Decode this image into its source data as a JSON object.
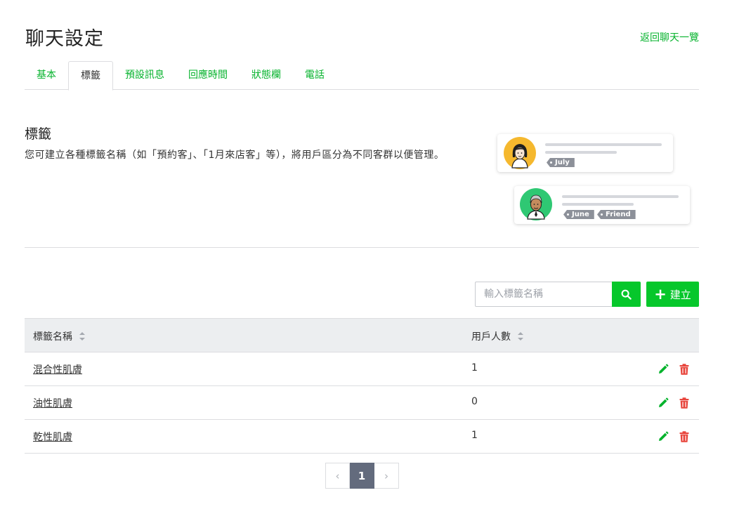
{
  "header": {
    "title": "聊天設定",
    "back_link": "返回聊天一覽"
  },
  "tabs": [
    {
      "label": "基本",
      "active": false
    },
    {
      "label": "標籤",
      "active": true
    },
    {
      "label": "預設訊息",
      "active": false
    },
    {
      "label": "回應時間",
      "active": false
    },
    {
      "label": "狀態欄",
      "active": false
    },
    {
      "label": "電話",
      "active": false
    }
  ],
  "section": {
    "title": "標籤",
    "description": "您可建立各種標籤名稱（如「預約客」、「1月來店客」等），將用戶區分為不同客群以便管理。"
  },
  "illustration": {
    "tag_1": "July",
    "tag_2": "June",
    "tag_3": "Friend"
  },
  "toolbar": {
    "search_placeholder": "輸入標籤名稱",
    "search_value": "",
    "create_label": "建立",
    "search_icon": "magnifier-icon"
  },
  "table": {
    "columns": {
      "name": "標籤名稱",
      "count": "用戶人數"
    },
    "rows": [
      {
        "name": "混合性肌膚",
        "count": "1"
      },
      {
        "name": "油性肌膚",
        "count": "0"
      },
      {
        "name": "乾性肌膚",
        "count": "1"
      }
    ]
  },
  "pagination": {
    "prev": "‹",
    "current": "1",
    "next": "›"
  },
  "colors": {
    "accent": "#06c72b",
    "link": "#06b32d",
    "delete": "#e8453c",
    "header_bg": "#eceef0",
    "pager_active": "#636b7d"
  }
}
